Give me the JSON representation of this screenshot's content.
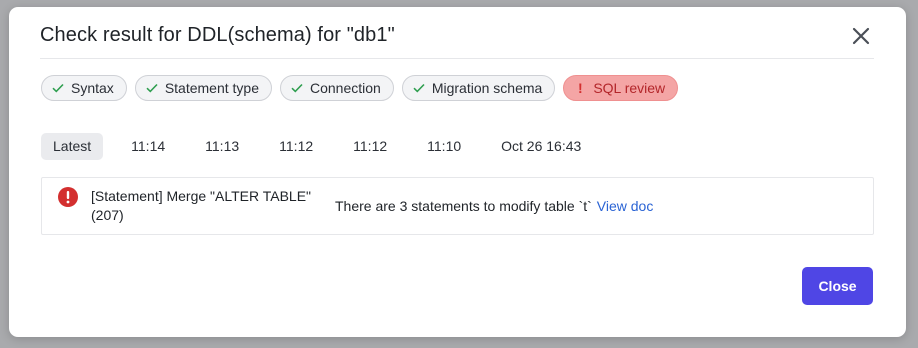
{
  "dialog": {
    "title": "Check result for DDL(schema) for \"db1\"",
    "close_button": "Close"
  },
  "checks": [
    {
      "label": "Syntax",
      "status": "success",
      "icon": "check-icon"
    },
    {
      "label": "Statement type",
      "status": "success",
      "icon": "check-icon"
    },
    {
      "label": "Connection",
      "status": "success",
      "icon": "check-icon"
    },
    {
      "label": "Migration schema",
      "status": "success",
      "icon": "check-icon"
    },
    {
      "label": "SQL review",
      "status": "error",
      "icon": "exclamation-icon"
    }
  ],
  "history_tabs": [
    "Latest",
    "11:14",
    "11:13",
    "11:12",
    "11:12",
    "11:10",
    "Oct 26 16:43"
  ],
  "active_tab": "Latest",
  "result": {
    "rule": "[Statement] Merge \"ALTER TABLE\" (207)",
    "message": "There are 3 statements to modify table `t`",
    "link": "View doc"
  },
  "colors": {
    "success": "#2e9e4f",
    "error": "#d32f2f",
    "error_chip_bg": "#f4a5a5",
    "primary": "#4f46e5",
    "link": "#2a63d4"
  }
}
